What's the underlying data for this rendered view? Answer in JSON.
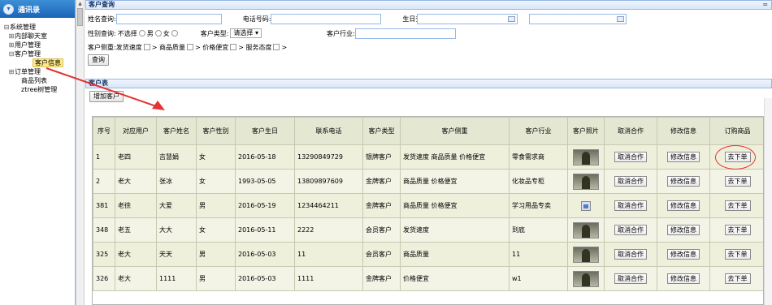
{
  "sidebar": {
    "title": "通讯录",
    "tree": [
      {
        "label": "系统管理",
        "toggle": "⊟",
        "level": "l1"
      },
      {
        "label": "内部聊天室",
        "toggle": "⊞",
        "level": "l2"
      },
      {
        "label": "用户管理",
        "toggle": "⊞",
        "level": "l2"
      },
      {
        "label": "客户管理",
        "toggle": "⊟",
        "level": "l2"
      },
      {
        "label": "客户信息",
        "toggle": "",
        "level": "l3",
        "selected": true
      },
      {
        "label": "订单管理",
        "toggle": "⊞",
        "level": "l2"
      },
      {
        "label": "商品列表",
        "toggle": "",
        "level": "lvl2b"
      },
      {
        "label": "ztree树管理",
        "toggle": "",
        "level": "lvl2b"
      }
    ]
  },
  "query": {
    "title": "客户查询",
    "name_label": "姓名查询:",
    "phone_label": "电话号码:",
    "birthday_label": "生日查询:",
    "gender_label": "性别查询:",
    "gender_options": [
      "不选择",
      "男",
      "女"
    ],
    "type_label": "客户类型:",
    "type_select": "请选择",
    "industry_label": "客户行业:",
    "side_label": "客户侧重:",
    "side_options": [
      "发货速度",
      "> 商品质量",
      "> 价格便宜",
      "> 服务态度",
      ">"
    ],
    "search_button": "查询"
  },
  "list": {
    "title": "客户表",
    "add_button": "增加客户",
    "columns": [
      "序号",
      "对应用户",
      "客户姓名",
      "客户性别",
      "客户生日",
      "联系电话",
      "客户类型",
      "客户侧重",
      "客户行业",
      "客户照片",
      "取消合作",
      "修改信息",
      "订购商品"
    ],
    "rows": [
      {
        "id": "1",
        "user": "老四",
        "name": "吉慧娟",
        "gender": "女",
        "birthday": "2016-05-18",
        "phone": "13290849729",
        "type": "银牌客户",
        "focus": "发货速度 商品质量 价格便宜",
        "industry": "零食需求商",
        "photo": "photo",
        "cancel": "取消合作",
        "edit": "修改信息",
        "order": "去下单"
      },
      {
        "id": "2",
        "user": "老大",
        "name": "张冰",
        "gender": "女",
        "birthday": "1993-05-05",
        "phone": "13809897609",
        "type": "金牌客户",
        "focus": "商品质量 价格便宜",
        "industry": "化妆品专柜",
        "photo": "photo",
        "cancel": "取消合作",
        "edit": "修改信息",
        "order": "去下单"
      },
      {
        "id": "381",
        "user": "老徐",
        "name": "大爱",
        "gender": "男",
        "birthday": "2016-05-19",
        "phone": "1234464211",
        "type": "金牌客户",
        "focus": "商品质量 价格便宜",
        "industry": "学习用品专卖",
        "photo": "broken",
        "cancel": "取消合作",
        "edit": "修改信息",
        "order": "去下单"
      },
      {
        "id": "348",
        "user": "老五",
        "name": "大大",
        "gender": "女",
        "birthday": "2016-05-11",
        "phone": "2222",
        "type": "会员客户",
        "focus": "发货速度",
        "industry": "到底",
        "photo": "photo",
        "cancel": "取消合作",
        "edit": "修改信息",
        "order": "去下单"
      },
      {
        "id": "325",
        "user": "老大",
        "name": "天天",
        "gender": "男",
        "birthday": "2016-05-03",
        "phone": "11",
        "type": "会员客户",
        "focus": "商品质量",
        "industry": "11",
        "photo": "photo",
        "cancel": "取消合作",
        "edit": "修改信息",
        "order": "去下单"
      },
      {
        "id": "326",
        "user": "老大",
        "name": "1111",
        "gender": "男",
        "birthday": "2016-05-03",
        "phone": "1111",
        "type": "金牌客户",
        "focus": "价格便宜",
        "industry": "w1",
        "photo": "photo",
        "cancel": "取消合作",
        "edit": "修改信息",
        "order": "去下单"
      }
    ]
  },
  "colors": {
    "accent": "#1b64b8",
    "annotation": "#e33333",
    "header_bg": "#e4e8d2"
  }
}
